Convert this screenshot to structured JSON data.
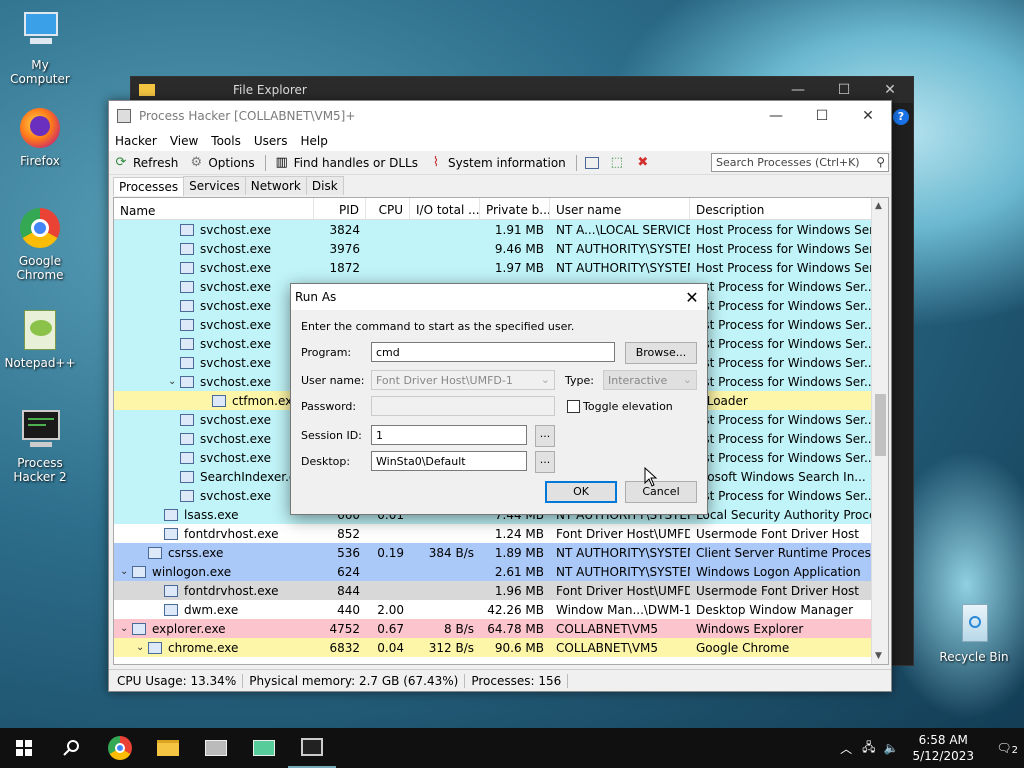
{
  "desktop": {
    "icons": [
      {
        "label": "My Computer"
      },
      {
        "label": "Firefox"
      },
      {
        "label": "Google Chrome"
      },
      {
        "label": "Notepad++"
      },
      {
        "label": "Process Hacker 2"
      },
      {
        "label": "Recycle Bin"
      }
    ]
  },
  "file_explorer": {
    "title": "File Explorer"
  },
  "process_hacker": {
    "title": "Process Hacker [COLLABNET\\VM5]+",
    "menu": [
      "Hacker",
      "View",
      "Tools",
      "Users",
      "Help"
    ],
    "toolbar": {
      "refresh": "Refresh",
      "options": "Options",
      "find_handles": "Find handles or DLLs",
      "system_info": "System information"
    },
    "search_placeholder": "Search Processes (Ctrl+K)",
    "tabs": [
      "Processes",
      "Services",
      "Network",
      "Disk"
    ],
    "columns": [
      "Name",
      "PID",
      "CPU",
      "I/O total ...",
      "Private b...",
      "User name",
      "Description"
    ],
    "rows": [
      {
        "name": "svchost.exe",
        "pid": "3824",
        "cpu": "",
        "io": "",
        "priv": "1.91 MB",
        "user": "NT A...\\LOCAL SERVICE",
        "desc": "Host Process for Windows Ser...",
        "indent": 3,
        "bg": "#c0f4f8"
      },
      {
        "name": "svchost.exe",
        "pid": "3976",
        "cpu": "",
        "io": "",
        "priv": "9.46 MB",
        "user": "NT AUTHORITY\\SYSTEM",
        "desc": "Host Process for Windows Ser...",
        "indent": 3,
        "bg": "#c0f4f8"
      },
      {
        "name": "svchost.exe",
        "pid": "1872",
        "cpu": "",
        "io": "",
        "priv": "1.97 MB",
        "user": "NT AUTHORITY\\SYSTEM",
        "desc": "Host Process for Windows Ser...",
        "indent": 3,
        "bg": "#c0f4f8"
      },
      {
        "name": "svchost.exe",
        "pid": "",
        "cpu": "",
        "io": "",
        "priv": "",
        "user": "",
        "desc": "ost Process for Windows Ser...",
        "indent": 3,
        "bg": "#c0f4f8"
      },
      {
        "name": "svchost.exe",
        "pid": "",
        "cpu": "",
        "io": "",
        "priv": "",
        "user": "",
        "desc": "ost Process for Windows Ser...",
        "indent": 3,
        "bg": "#c0f4f8"
      },
      {
        "name": "svchost.exe",
        "pid": "",
        "cpu": "",
        "io": "",
        "priv": "",
        "user": "",
        "desc": "ost Process for Windows Ser...",
        "indent": 3,
        "bg": "#c0f4f8"
      },
      {
        "name": "svchost.exe",
        "pid": "",
        "cpu": "",
        "io": "",
        "priv": "",
        "user": "",
        "desc": "ost Process for Windows Ser...",
        "indent": 3,
        "bg": "#c0f4f8"
      },
      {
        "name": "svchost.exe",
        "pid": "",
        "cpu": "",
        "io": "",
        "priv": "",
        "user": "",
        "desc": "ost Process for Windows Ser...",
        "indent": 3,
        "bg": "#c0f4f8"
      },
      {
        "name": "svchost.exe",
        "pid": "",
        "cpu": "",
        "io": "",
        "priv": "",
        "user": "",
        "desc": "ost Process for Windows Ser...",
        "indent": 3,
        "bg": "#c0f4f8",
        "expand": "⌄"
      },
      {
        "name": "ctfmon.exe",
        "pid": "",
        "cpu": "",
        "io": "",
        "priv": "",
        "user": "",
        "desc": "F Loader",
        "indent": 5,
        "bg": "#fdf6a8"
      },
      {
        "name": "svchost.exe",
        "pid": "",
        "cpu": "",
        "io": "",
        "priv": "",
        "user": "",
        "desc": "ost Process for Windows Ser...",
        "indent": 3,
        "bg": "#c0f4f8"
      },
      {
        "name": "svchost.exe",
        "pid": "",
        "cpu": "",
        "io": "",
        "priv": "",
        "user": "",
        "desc": "ost Process for Windows Ser...",
        "indent": 3,
        "bg": "#c0f4f8"
      },
      {
        "name": "svchost.exe",
        "pid": "",
        "cpu": "",
        "io": "",
        "priv": "",
        "user": "",
        "desc": "ost Process for Windows Ser...",
        "indent": 3,
        "bg": "#c0f4f8"
      },
      {
        "name": "SearchIndexer.exe",
        "pid": "",
        "cpu": "",
        "io": "",
        "priv": "",
        "user": "",
        "desc": "crosoft Windows Search In...",
        "indent": 3,
        "bg": "#c0f4f8"
      },
      {
        "name": "svchost.exe",
        "pid": "",
        "cpu": "",
        "io": "",
        "priv": "",
        "user": "",
        "desc": "ost Process for Windows Ser...",
        "indent": 3,
        "bg": "#c0f4f8"
      },
      {
        "name": "lsass.exe",
        "pid": "660",
        "cpu": "0.01",
        "io": "",
        "priv": "7.44 MB",
        "user": "NT AUTHORITY\\SYSTEM",
        "desc": "Local Security Authority Proce...",
        "indent": 2,
        "bg": "#c0f4f8"
      },
      {
        "name": "fontdrvhost.exe",
        "pid": "852",
        "cpu": "",
        "io": "",
        "priv": "1.24 MB",
        "user": "Font Driver Host\\UMFD-",
        "desc": "Usermode Font Driver Host",
        "indent": 2,
        "bg": "#ffffff"
      },
      {
        "name": "csrss.exe",
        "pid": "536",
        "cpu": "0.19",
        "io": "384 B/s",
        "priv": "1.89 MB",
        "user": "NT AUTHORITY\\SYSTEM",
        "desc": "Client Server Runtime Process",
        "indent": 1,
        "bg": "#aac8f8"
      },
      {
        "name": "winlogon.exe",
        "pid": "624",
        "cpu": "",
        "io": "",
        "priv": "2.61 MB",
        "user": "NT AUTHORITY\\SYSTEM",
        "desc": "Windows Logon Application",
        "indent": 0,
        "bg": "#aac8f8",
        "expand": "⌄"
      },
      {
        "name": "fontdrvhost.exe",
        "pid": "844",
        "cpu": "",
        "io": "",
        "priv": "1.96 MB",
        "user": "Font Driver Host\\UMFD-",
        "desc": "Usermode Font Driver Host",
        "indent": 2,
        "bg": "#d8d8d8"
      },
      {
        "name": "dwm.exe",
        "pid": "440",
        "cpu": "2.00",
        "io": "",
        "priv": "42.26 MB",
        "user": "Window Man...\\DWM-1",
        "desc": "Desktop Window Manager",
        "indent": 2,
        "bg": "#ffffff"
      },
      {
        "name": "explorer.exe",
        "pid": "4752",
        "cpu": "0.67",
        "io": "8 B/s",
        "priv": "64.78 MB",
        "user": "COLLABNET\\VM5",
        "desc": "Windows Explorer",
        "indent": 0,
        "bg": "#fcc4cc",
        "expand": "⌄"
      },
      {
        "name": "chrome.exe",
        "pid": "6832",
        "cpu": "0.04",
        "io": "312 B/s",
        "priv": "90.6 MB",
        "user": "COLLABNET\\VM5",
        "desc": "Google Chrome",
        "indent": 1,
        "bg": "#fdf6a8",
        "expand": "⌄"
      }
    ],
    "status": {
      "cpu": "CPU Usage: 13.34%",
      "mem": "Physical memory: 2.7 GB (67.43%)",
      "procs": "Processes: 156"
    }
  },
  "run_as": {
    "title": "Run As",
    "intro": "Enter the command to start as the specified user.",
    "program_label": "Program:",
    "program_value": "cmd",
    "browse": "Browse...",
    "username_label": "User name:",
    "username_value": "Font Driver Host\\UMFD-1",
    "type_label": "Type:",
    "type_value": "Interactive",
    "password_label": "Password:",
    "toggle_elevation": "Toggle elevation",
    "session_label": "Session ID:",
    "session_value": "1",
    "desktop_label": "Desktop:",
    "desktop_value": "WinSta0\\Default",
    "ellipsis": "...",
    "ok": "OK",
    "cancel": "Cancel"
  },
  "taskbar": {
    "time": "6:58 AM",
    "date": "5/12/2023",
    "notif_count": "2"
  }
}
